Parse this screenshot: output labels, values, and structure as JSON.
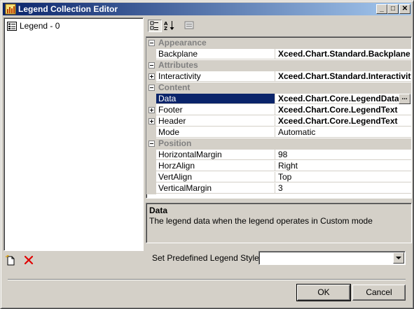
{
  "window": {
    "title": "Legend Collection Editor"
  },
  "left_list": {
    "items": [
      {
        "label": "Legend - 0"
      }
    ]
  },
  "grid": {
    "categories": [
      {
        "name": "Appearance",
        "rows": [
          {
            "name": "Backplane",
            "value": "Xceed.Chart.Standard.Backplane"
          }
        ]
      },
      {
        "name": "Attributes",
        "rows": [
          {
            "name": "Interactivity",
            "value": "Xceed.Chart.Standard.Interactivity"
          }
        ]
      },
      {
        "name": "Content",
        "rows": [
          {
            "name": "Data",
            "value": "Xceed.Chart.Core.LegendData"
          },
          {
            "name": "Footer",
            "value": "Xceed.Chart.Core.LegendText"
          },
          {
            "name": "Header",
            "value": "Xceed.Chart.Core.LegendText"
          },
          {
            "name": "Mode",
            "value": "Automatic"
          }
        ]
      },
      {
        "name": "Position",
        "rows": [
          {
            "name": "HorizontalMargin",
            "value": "98"
          },
          {
            "name": "HorzAlign",
            "value": "Right"
          },
          {
            "name": "VertAlign",
            "value": "Top"
          },
          {
            "name": "VerticalMargin",
            "value": "3"
          }
        ]
      }
    ],
    "ellipsis": "..."
  },
  "description": {
    "title": "Data",
    "text": "The legend data when the legend operates in Custom mode"
  },
  "legend_style": {
    "label": "Set Predefined Legend Style:",
    "value": ""
  },
  "buttons": {
    "ok": "OK",
    "cancel": "Cancel"
  },
  "titlebar_buttons": {
    "minimize": "_",
    "maximize": "□",
    "close": "✕"
  }
}
